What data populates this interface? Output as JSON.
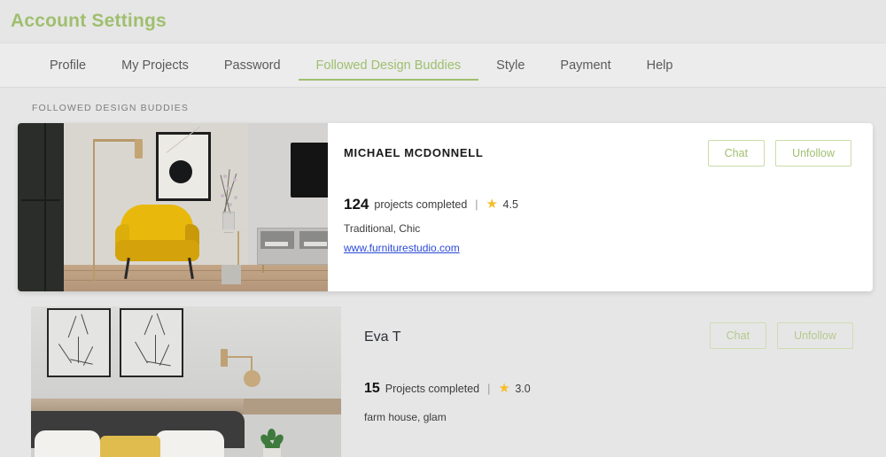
{
  "header": {
    "title": "Account Settings",
    "title_color": "#9FBF6E"
  },
  "tabs": [
    {
      "label": "Profile",
      "active": false
    },
    {
      "label": "My Projects",
      "active": false
    },
    {
      "label": "Password",
      "active": false
    },
    {
      "label": "Followed Design Buddies",
      "active": true
    },
    {
      "label": "Style",
      "active": false
    },
    {
      "label": "Payment",
      "active": false
    },
    {
      "label": "Help",
      "active": false
    }
  ],
  "section": {
    "label": "FOLLOWED DESIGN BUDDIES"
  },
  "accent_color": "#9FBF6E",
  "star_color": "#F5BE2E",
  "link_color": "#2B49D6",
  "buddies": [
    {
      "name": "MICHAEL MCDONNELL",
      "projects_count": "124",
      "projects_label": "projects completed",
      "separator": "|",
      "star_icon": "star-icon",
      "rating": "4.5",
      "tags": "Traditional, Chic",
      "website": "www.furniturestudio.com",
      "chat_label": "Chat",
      "unfollow_label": "Unfollow",
      "thumbnail_alt": "living-room-yellow-armchair"
    },
    {
      "name": "Eva T",
      "projects_count": "15",
      "projects_label": "Projects completed",
      "separator": "|",
      "star_icon": "star-icon",
      "rating": "3.0",
      "tags": "farm house, glam",
      "chat_label": "Chat",
      "unfollow_label": "Unfollow",
      "thumbnail_alt": "bedroom-line-art-prints"
    }
  ]
}
